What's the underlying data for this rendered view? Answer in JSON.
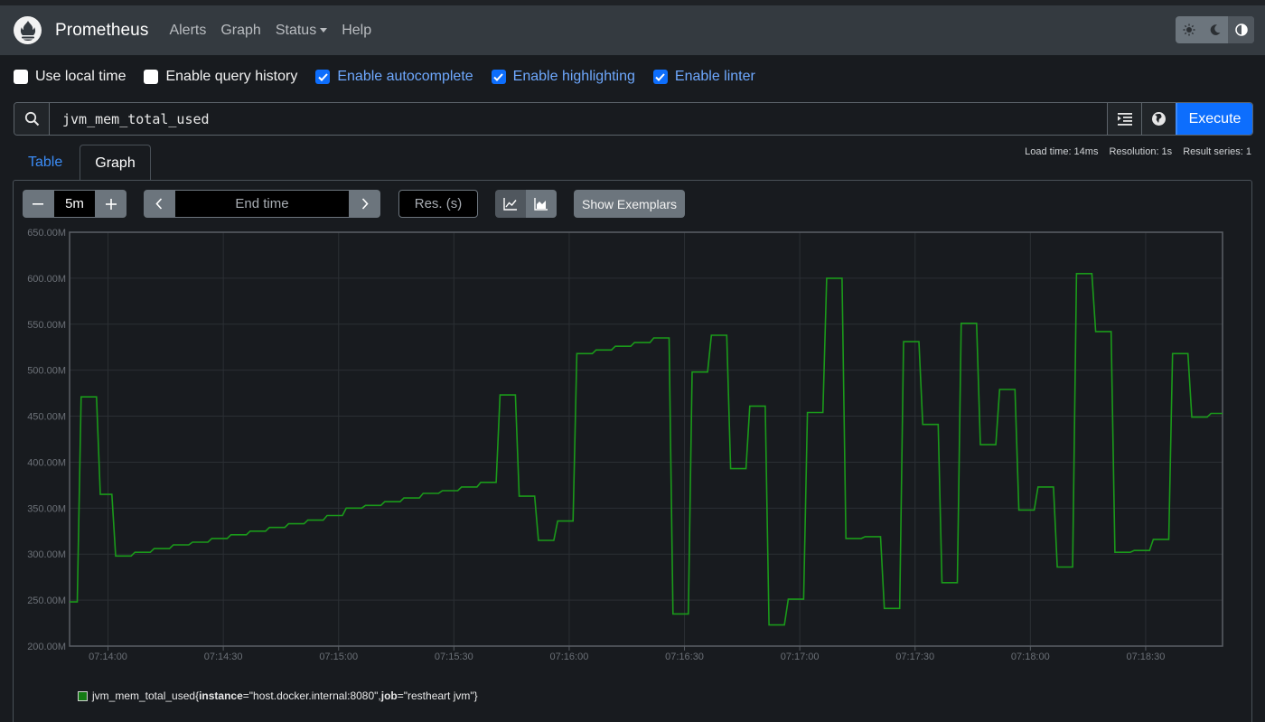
{
  "navbar": {
    "brand": "Prometheus",
    "logo_icon": "prometheus-flame-icon",
    "links": [
      "Alerts",
      "Graph",
      "Status",
      "Help"
    ],
    "theme_buttons": [
      "sun-icon",
      "moon-icon",
      "contrast-icon"
    ],
    "active_theme_index": 2
  },
  "options": [
    {
      "label": "Use local time",
      "checked": false
    },
    {
      "label": "Enable query history",
      "checked": false
    },
    {
      "label": "Enable autocomplete",
      "checked": true
    },
    {
      "label": "Enable highlighting",
      "checked": true
    },
    {
      "label": "Enable linter",
      "checked": true
    }
  ],
  "query": {
    "value": "jvm_mem_total_used",
    "execute_label": "Execute"
  },
  "tabs": [
    {
      "label": "Table",
      "active": false
    },
    {
      "label": "Graph",
      "active": true
    }
  ],
  "stats": {
    "load_time": "Load time: 14ms",
    "resolution": "Resolution: 1s",
    "result_series": "Result series: 1"
  },
  "controls": {
    "range_value": "5m",
    "end_time_placeholder": "End time",
    "resolution_placeholder": "Res. (s)",
    "exemplars_label": "Show Exemplars"
  },
  "colors": {
    "series": "#1a9a1a",
    "accent": "#0d6efd"
  },
  "chart_data": {
    "type": "line",
    "title": "",
    "xlabel": "",
    "ylabel": "",
    "x_tick_labels": [
      "07:14:00",
      "07:14:30",
      "07:15:00",
      "07:15:30",
      "07:16:00",
      "07:16:30",
      "07:17:00",
      "07:17:30",
      "07:18:00",
      "07:18:30"
    ],
    "y_tick_labels": [
      "200.00M",
      "250.00M",
      "300.00M",
      "350.00M",
      "400.00M",
      "450.00M",
      "500.00M",
      "550.00M",
      "600.00M",
      "650.00M"
    ],
    "ylim": [
      200000000,
      650000000
    ],
    "xlim": [
      "07:13:50",
      "07:18:50"
    ],
    "grid": true,
    "legend_position": "bottom-left",
    "series": [
      {
        "legend": {
          "metric": "jvm_mem_total_used",
          "label1_key": "instance",
          "label1_value": "host.docker.internal:8080",
          "label2_key": "job",
          "label2_value": "restheart jvm"
        },
        "points": [
          [
            "07:13:50",
            248
          ],
          [
            "07:13:52",
            248
          ],
          [
            "07:13:53",
            471
          ],
          [
            "07:13:57",
            471
          ],
          [
            "07:13:58",
            365
          ],
          [
            "07:14:01",
            365
          ],
          [
            "07:14:02",
            298
          ],
          [
            "07:14:06",
            298
          ],
          [
            "07:14:07",
            302
          ],
          [
            "07:14:11",
            302
          ],
          [
            "07:14:12",
            306
          ],
          [
            "07:14:16",
            306
          ],
          [
            "07:14:17",
            310
          ],
          [
            "07:14:21",
            310
          ],
          [
            "07:14:22",
            313
          ],
          [
            "07:14:26",
            313
          ],
          [
            "07:14:27",
            317
          ],
          [
            "07:14:31",
            317
          ],
          [
            "07:14:32",
            321
          ],
          [
            "07:14:36",
            321
          ],
          [
            "07:14:37",
            325
          ],
          [
            "07:14:41",
            325
          ],
          [
            "07:14:42",
            329
          ],
          [
            "07:14:46",
            329
          ],
          [
            "07:14:47",
            333
          ],
          [
            "07:14:51",
            333
          ],
          [
            "07:14:52",
            337
          ],
          [
            "07:14:56",
            337
          ],
          [
            "07:14:57",
            342
          ],
          [
            "07:15:01",
            342
          ],
          [
            "07:15:02",
            350
          ],
          [
            "07:15:06",
            350
          ],
          [
            "07:15:07",
            353
          ],
          [
            "07:15:11",
            353
          ],
          [
            "07:15:12",
            357
          ],
          [
            "07:15:16",
            357
          ],
          [
            "07:15:17",
            361
          ],
          [
            "07:15:21",
            361
          ],
          [
            "07:15:22",
            366
          ],
          [
            "07:15:26",
            366
          ],
          [
            "07:15:27",
            369
          ],
          [
            "07:15:31",
            369
          ],
          [
            "07:15:32",
            373
          ],
          [
            "07:15:36",
            373
          ],
          [
            "07:15:37",
            378
          ],
          [
            "07:15:41",
            378
          ],
          [
            "07:15:42",
            473
          ],
          [
            "07:15:46",
            473
          ],
          [
            "07:15:47",
            363
          ],
          [
            "07:15:51",
            363
          ],
          [
            "07:15:52",
            315
          ],
          [
            "07:15:56",
            315
          ],
          [
            "07:15:57",
            336
          ],
          [
            "07:16:01",
            336
          ],
          [
            "07:16:02",
            518
          ],
          [
            "07:16:06",
            518
          ],
          [
            "07:16:07",
            522
          ],
          [
            "07:16:11",
            522
          ],
          [
            "07:16:12",
            526
          ],
          [
            "07:16:16",
            526
          ],
          [
            "07:16:17",
            530
          ],
          [
            "07:16:21",
            530
          ],
          [
            "07:16:22",
            535
          ],
          [
            "07:16:26",
            535
          ],
          [
            "07:16:27",
            235
          ],
          [
            "07:16:31",
            235
          ],
          [
            "07:16:32",
            498
          ],
          [
            "07:16:36",
            498
          ],
          [
            "07:16:37",
            538
          ],
          [
            "07:16:41",
            538
          ],
          [
            "07:16:42",
            393
          ],
          [
            "07:16:46",
            393
          ],
          [
            "07:16:47",
            461
          ],
          [
            "07:16:51",
            461
          ],
          [
            "07:16:52",
            223
          ],
          [
            "07:16:56",
            223
          ],
          [
            "07:16:57",
            251
          ],
          [
            "07:17:01",
            251
          ],
          [
            "07:17:02",
            454
          ],
          [
            "07:17:06",
            454
          ],
          [
            "07:17:07",
            600
          ],
          [
            "07:17:11",
            600
          ],
          [
            "07:17:12",
            317
          ],
          [
            "07:17:16",
            317
          ],
          [
            "07:17:17",
            319
          ],
          [
            "07:17:21",
            319
          ],
          [
            "07:17:22",
            241
          ],
          [
            "07:17:26",
            241
          ],
          [
            "07:17:27",
            531
          ],
          [
            "07:17:31",
            531
          ],
          [
            "07:17:32",
            441
          ],
          [
            "07:17:36",
            441
          ],
          [
            "07:17:37",
            269
          ],
          [
            "07:17:41",
            269
          ],
          [
            "07:17:42",
            551
          ],
          [
            "07:17:46",
            551
          ],
          [
            "07:17:47",
            419
          ],
          [
            "07:17:51",
            419
          ],
          [
            "07:17:52",
            479
          ],
          [
            "07:17:56",
            479
          ],
          [
            "07:17:57",
            348
          ],
          [
            "07:18:01",
            348
          ],
          [
            "07:18:02",
            373
          ],
          [
            "07:18:06",
            373
          ],
          [
            "07:18:07",
            286
          ],
          [
            "07:18:11",
            286
          ],
          [
            "07:18:12",
            605
          ],
          [
            "07:18:16",
            605
          ],
          [
            "07:18:17",
            542
          ],
          [
            "07:18:21",
            542
          ],
          [
            "07:18:22",
            302
          ],
          [
            "07:18:26",
            302
          ],
          [
            "07:18:27",
            304
          ],
          [
            "07:18:31",
            304
          ],
          [
            "07:18:32",
            316
          ],
          [
            "07:18:36",
            316
          ],
          [
            "07:18:37",
            518
          ],
          [
            "07:18:41",
            518
          ],
          [
            "07:18:42",
            449
          ],
          [
            "07:18:46",
            449
          ],
          [
            "07:18:47",
            453
          ],
          [
            "07:18:50",
            453
          ]
        ],
        "y_unit_note": "values in millions"
      }
    ]
  }
}
